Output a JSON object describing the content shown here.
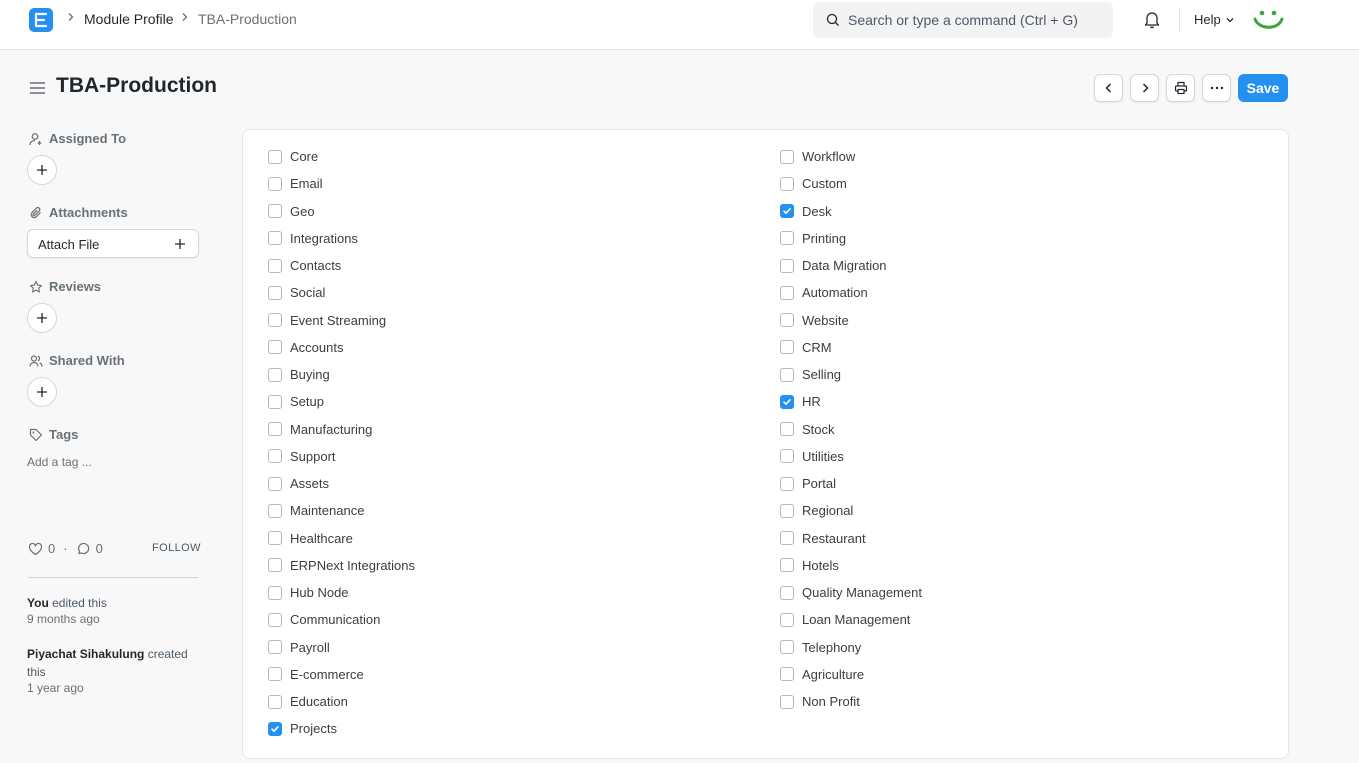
{
  "navbar": {
    "breadcrumbs": [
      "Module Profile",
      "TBA-Production"
    ],
    "search_placeholder": "Search or type a command (Ctrl + G)",
    "help_label": "Help",
    "icons": [
      "app-logo-icon",
      "bell-icon",
      "search-icon",
      "chevron-down-icon",
      "user-avatar"
    ]
  },
  "page": {
    "title": "TBA-Production",
    "save_label": "Save"
  },
  "sidebar": {
    "assigned_to": "Assigned To",
    "attachments": "Attachments",
    "attach_file": "Attach File",
    "reviews": "Reviews",
    "shared_with": "Shared With",
    "tags": "Tags",
    "add_tag": "Add a tag ...",
    "likes": "0",
    "comments": "0",
    "follow": "FOLLOW",
    "activity": [
      {
        "user": "You",
        "action": " edited this",
        "time": "9 months ago"
      },
      {
        "user": "Piyachat Sihakulung",
        "action": " created this",
        "time": "1 year ago"
      }
    ]
  },
  "modules": {
    "left": [
      {
        "label": "Core",
        "checked": false
      },
      {
        "label": "Email",
        "checked": false
      },
      {
        "label": "Geo",
        "checked": false
      },
      {
        "label": "Integrations",
        "checked": false
      },
      {
        "label": "Contacts",
        "checked": false
      },
      {
        "label": "Social",
        "checked": false
      },
      {
        "label": "Event Streaming",
        "checked": false
      },
      {
        "label": "Accounts",
        "checked": false
      },
      {
        "label": "Buying",
        "checked": false
      },
      {
        "label": "Setup",
        "checked": false
      },
      {
        "label": "Manufacturing",
        "checked": false
      },
      {
        "label": "Support",
        "checked": false
      },
      {
        "label": "Assets",
        "checked": false
      },
      {
        "label": "Maintenance",
        "checked": false
      },
      {
        "label": "Healthcare",
        "checked": false
      },
      {
        "label": "ERPNext Integrations",
        "checked": false
      },
      {
        "label": "Hub Node",
        "checked": false
      },
      {
        "label": "Communication",
        "checked": false
      },
      {
        "label": "Payroll",
        "checked": false
      },
      {
        "label": "E-commerce",
        "checked": false
      },
      {
        "label": "Education",
        "checked": false
      },
      {
        "label": "Projects",
        "checked": true
      }
    ],
    "right": [
      {
        "label": "Workflow",
        "checked": false
      },
      {
        "label": "Custom",
        "checked": false
      },
      {
        "label": "Desk",
        "checked": true
      },
      {
        "label": "Printing",
        "checked": false
      },
      {
        "label": "Data Migration",
        "checked": false
      },
      {
        "label": "Automation",
        "checked": false
      },
      {
        "label": "Website",
        "checked": false
      },
      {
        "label": "CRM",
        "checked": false
      },
      {
        "label": "Selling",
        "checked": false
      },
      {
        "label": "HR",
        "checked": true
      },
      {
        "label": "Stock",
        "checked": false
      },
      {
        "label": "Utilities",
        "checked": false
      },
      {
        "label": "Portal",
        "checked": false
      },
      {
        "label": "Regional",
        "checked": false
      },
      {
        "label": "Restaurant",
        "checked": false
      },
      {
        "label": "Hotels",
        "checked": false
      },
      {
        "label": "Quality Management",
        "checked": false
      },
      {
        "label": "Loan Management",
        "checked": false
      },
      {
        "label": "Telephony",
        "checked": false
      },
      {
        "label": "Agriculture",
        "checked": false
      },
      {
        "label": "Non Profit",
        "checked": false
      }
    ]
  },
  "colors": {
    "primary": "#2490ef",
    "logo_smile": "#3ba63b"
  }
}
